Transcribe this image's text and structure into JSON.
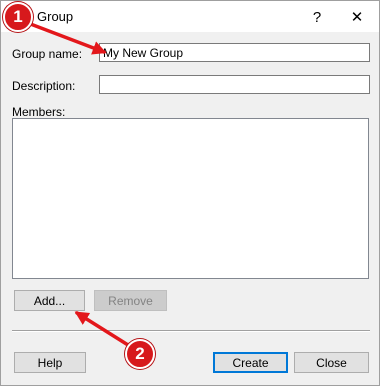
{
  "window": {
    "title": "Group",
    "help_glyph": "?",
    "close_glyph": "✕"
  },
  "form": {
    "group_name_label": "Group name:",
    "group_name_value": "My New Group",
    "description_label": "Description:",
    "description_value": "",
    "members_label": "Members:",
    "members": []
  },
  "buttons": {
    "add": "Add...",
    "remove": "Remove",
    "help": "Help",
    "create": "Create",
    "close": "Close"
  },
  "annotations": {
    "step1": "1",
    "step2": "2",
    "marker_color": "#d7191c",
    "arrow_color": "#e3171b"
  }
}
